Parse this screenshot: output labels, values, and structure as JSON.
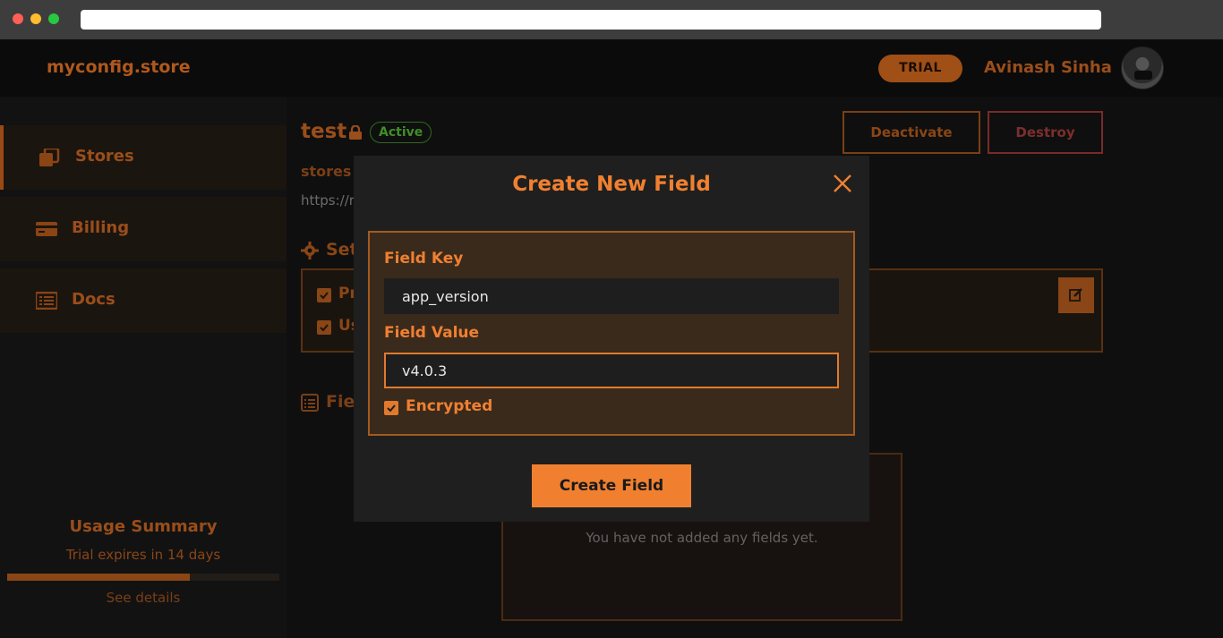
{
  "header": {
    "logo": "myconfig.store",
    "trial_badge": "TRIAL",
    "user_name": "Avinash Sinha"
  },
  "sidebar": {
    "items": [
      {
        "label": "Stores",
        "icon": "copy-icon"
      },
      {
        "label": "Billing",
        "icon": "credit-card-icon"
      },
      {
        "label": "Docs",
        "icon": "list-icon"
      }
    ],
    "usage": {
      "title": "Usage Summary",
      "subtitle": "Trial expires in 14 days",
      "progress_percent": 67,
      "see_details": "See details"
    }
  },
  "main": {
    "store_name": "test",
    "status": "Active",
    "deactivate_label": "Deactivate",
    "destroy_label": "Destroy",
    "breadcrumb": "stores",
    "url_prefix": "https://r",
    "settings_title": "Set",
    "settings_items": [
      "Pr",
      "Us"
    ],
    "fields_title": "Fiel",
    "empty_text": "You have not added any fields yet."
  },
  "modal": {
    "title": "Create New Field",
    "field_key_label": "Field Key",
    "field_key_value": "app_version",
    "field_value_label": "Field Value",
    "field_value_value": "v4.0.3",
    "encrypted_label": "Encrypted",
    "encrypted_checked": true,
    "submit_label": "Create Field"
  },
  "colors": {
    "accent": "#f08030",
    "muted_accent": "#9a4e1a",
    "success": "#3f8e27",
    "danger": "#7c2e2e"
  }
}
